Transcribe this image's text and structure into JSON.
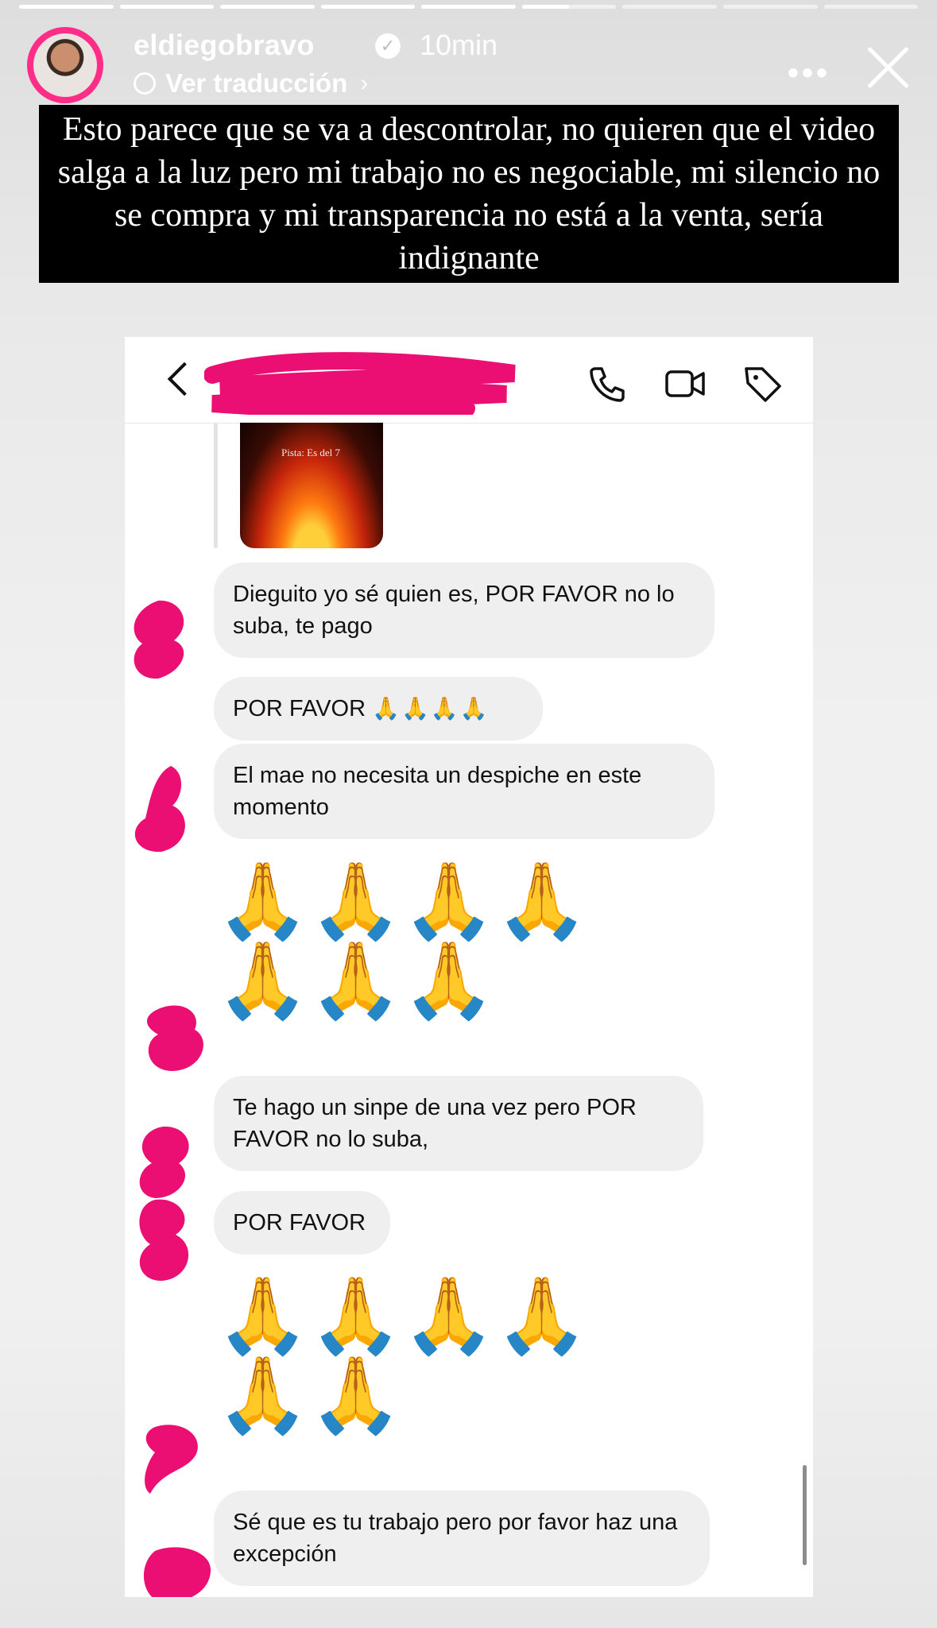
{
  "story": {
    "username": "eldiegobravo",
    "verified_icon": "verified-badge-icon",
    "time": "10min",
    "translate_label": "Ver traducción",
    "progress_segments": [
      1,
      1,
      1,
      1,
      1,
      0.5,
      0,
      0,
      0
    ],
    "caption": "Esto parece que se va a descontrolar, no quieren que el video salga a la luz pero mi trabajo no es negociable, mi silencio no se compra y mi transparencia no está a la venta, sería indignante"
  },
  "dm": {
    "header_icons": [
      "back-icon",
      "phone-icon",
      "video-call-icon",
      "tag-icon"
    ],
    "shared_story_text": "Pista: Es del 7",
    "messages": [
      {
        "text": "Dieguito yo sé quien es, POR FAVOR no lo suba, te pago"
      },
      {
        "text": "POR FAVOR",
        "emoji": "🙏🙏🙏🙏"
      },
      {
        "text": "El mae no necesita un despiche en este momento"
      },
      {
        "emoji": "🙏🙏🙏🙏🙏🙏🙏"
      },
      {
        "text": "Te hago un sinpe de una vez pero POR FAVOR no lo suba,"
      },
      {
        "text": "POR FAVOR"
      },
      {
        "emoji": "🙏🙏🙏🙏🙏🙏"
      },
      {
        "text": "Sé que es tu trabajo pero por favor haz una excepción"
      }
    ]
  },
  "colors": {
    "redaction": "#ec0f73",
    "avatar_ring": "#ff2d87",
    "bubble": "#efefef"
  }
}
